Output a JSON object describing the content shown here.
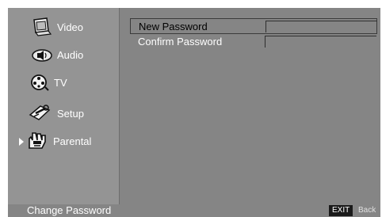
{
  "sidebar": {
    "items": [
      {
        "label": "Video",
        "icon": "monitor-icon"
      },
      {
        "label": "Audio",
        "icon": "speaker-icon"
      },
      {
        "label": "TV",
        "icon": "tv-reel-icon"
      },
      {
        "label": "Setup",
        "icon": "wrench-icon"
      },
      {
        "label": "Parental",
        "icon": "parental-hand-icon"
      }
    ],
    "selected": "Parental"
  },
  "form": {
    "new_password_label": "New Password",
    "new_password_value": "",
    "confirm_password_label": "Confirm Password",
    "confirm_password_value": ""
  },
  "status_bar": {
    "title": "Change Password",
    "exit_label": "EXIT",
    "back_label": "Back"
  },
  "colors": {
    "panel": "#858585",
    "sidebar": "#949494",
    "text_light": "#ffffff",
    "text_dark": "#000000",
    "exit_key_bg": "#1a1a1a"
  }
}
